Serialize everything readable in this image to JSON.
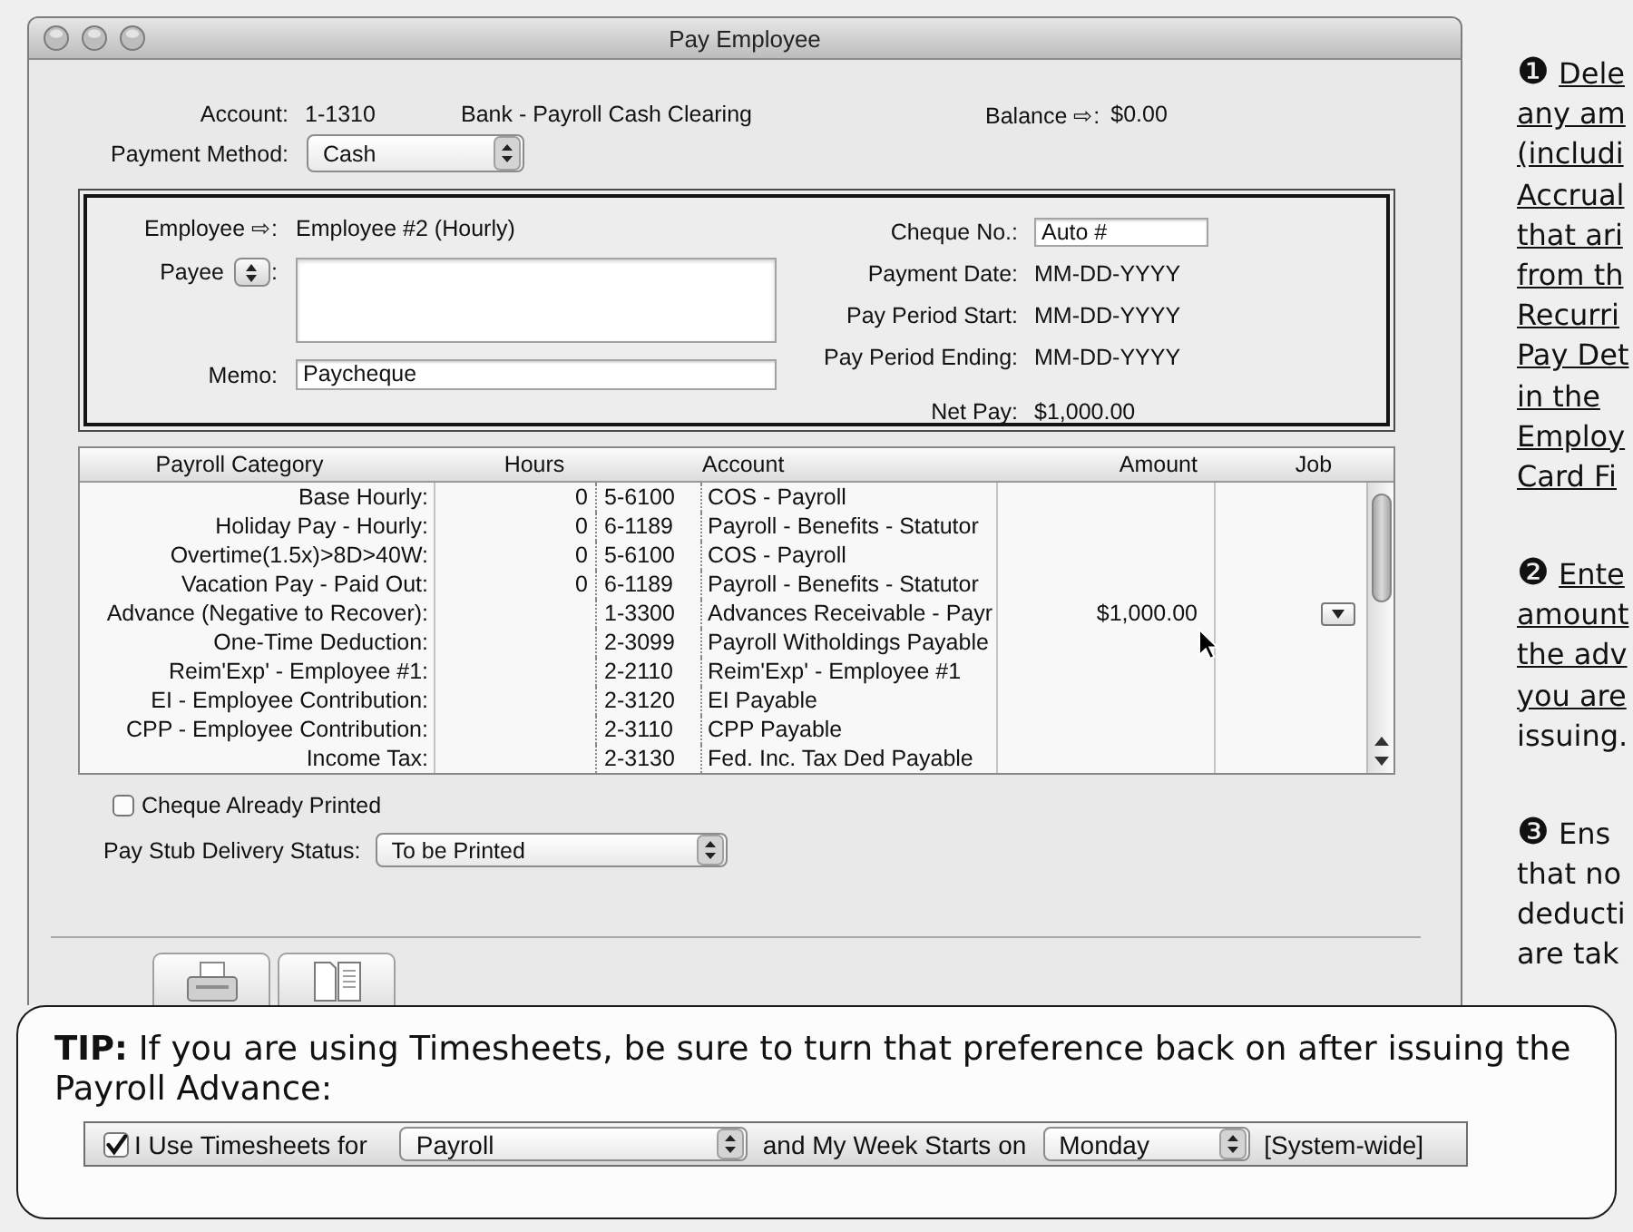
{
  "window": {
    "title": "Pay Employee"
  },
  "header": {
    "account_label": "Account:",
    "account_number": "1-1310",
    "account_name": "Bank - Payroll Cash Clearing",
    "balance_label": "Balance ⇨:",
    "balance": "$0.00",
    "payment_method_label": "Payment Method:",
    "payment_method": "Cash"
  },
  "employee_panel": {
    "employee_label": "Employee ⇨:",
    "employee": "Employee #2 (Hourly)",
    "payee_label": "Payee",
    "payee_colon": ":",
    "memo_label": "Memo:",
    "memo": "Paycheque",
    "fields": [
      {
        "kind": "input",
        "label": "Cheque No.:",
        "value": "Auto #"
      },
      {
        "kind": "text",
        "label": "Payment Date:",
        "value": "MM-DD-YYYY"
      },
      {
        "kind": "text",
        "label": "Pay Period Start:",
        "value": "MM-DD-YYYY"
      },
      {
        "kind": "text",
        "label": "Pay Period Ending:",
        "value": "MM-DD-YYYY"
      },
      {
        "kind": "total",
        "label": "Net Pay:",
        "value": "$1,000.00"
      }
    ]
  },
  "table": {
    "columns": [
      "Payroll Category",
      "Hours",
      "Account",
      "Amount",
      "Job"
    ],
    "rows": [
      {
        "category": "Base Hourly:",
        "hours": "0",
        "account_number": "5-6100",
        "account_name": "COS - Payroll",
        "job_menu": false
      },
      {
        "category": "Holiday Pay - Hourly:",
        "hours": "0",
        "account_number": "6-1189",
        "account_name": "Payroll - Benefits - Statutor",
        "job_menu": false
      },
      {
        "category": "Overtime(1.5x)>8D>40W:",
        "hours": "0",
        "account_number": "5-6100",
        "account_name": "COS - Payroll",
        "job_menu": false
      },
      {
        "category": "Vacation Pay - Paid Out:",
        "hours": "0",
        "account_number": "6-1189",
        "account_name": "Payroll - Benefits - Statutor",
        "job_menu": false
      },
      {
        "category": "Advance (Negative to Recover):",
        "account_number": "1-3300",
        "account_name": "Advances Receivable - Payr",
        "amount": "$1,000.00",
        "job_menu": true
      },
      {
        "category": "One-Time Deduction:",
        "account_number": "2-3099",
        "account_name": "Payroll Witholdings Payable",
        "job_menu": false
      },
      {
        "category": "Reim'Exp' - Employee #1:",
        "account_number": "2-2110",
        "account_name": "Reim'Exp' - Employee #1",
        "job_menu": false
      },
      {
        "category": "EI - Employee Contribution:",
        "account_number": "2-3120",
        "account_name": "EI Payable",
        "job_menu": false
      },
      {
        "category": "CPP - Employee Contribution:",
        "account_number": "2-3110",
        "account_name": "CPP Payable",
        "job_menu": false
      },
      {
        "category": "Income Tax:",
        "account_number": "2-3130",
        "account_name": "Fed. Inc. Tax Ded Payable",
        "job_menu": false
      }
    ]
  },
  "options": {
    "cheque_printed": {
      "label": "Cheque Already Printed",
      "checked": false
    },
    "delivery_label": "Pay Stub Delivery Status:",
    "delivery_status": "To be Printed"
  },
  "notes": [
    {
      "number": "❶",
      "lines": [
        {
          "text": "Dele",
          "underlined": true
        },
        {
          "text": "any am",
          "underlined": true
        },
        {
          "text": "(includi",
          "underlined": true
        },
        {
          "text": "Accrual",
          "underlined": true
        },
        {
          "text": "that ari",
          "underlined": true
        },
        {
          "text": "from th",
          "underlined": true
        },
        {
          "text": "Recurri",
          "underlined": true
        },
        {
          "text": "Pay Det",
          "underlined": true
        },
        {
          "text": "in the",
          "underlined": true
        },
        {
          "text": "Employ",
          "underlined": true
        },
        {
          "text": "Card Fi",
          "underlined": true
        }
      ]
    },
    {
      "number": "❷",
      "lines": [
        {
          "text": "Ente",
          "underlined": true
        },
        {
          "text": "amount",
          "underlined": true
        },
        {
          "text": "the adv",
          "underlined": true
        },
        {
          "text": "you are",
          "underlined": true
        },
        {
          "text": "issuing.",
          "underlined": false
        }
      ]
    },
    {
      "number": "❸",
      "lines": [
        {
          "text": "Ens",
          "underlined": false
        },
        {
          "text": "that no",
          "underlined": false
        },
        {
          "text": "deducti",
          "underlined": false
        },
        {
          "text": "are tak",
          "underlined": false
        }
      ]
    }
  ],
  "tip": {
    "text": "**TIP:** If you are using Timesheets, be sure to turn that preference back on after issuing the Payroll Advance:",
    "preference": {
      "checked": true,
      "label": "I Use Timesheets for",
      "timesheets_for": "Payroll",
      "week_label": "and My Week Starts on",
      "week_start": "Monday",
      "scope": "[System-wide]"
    }
  }
}
